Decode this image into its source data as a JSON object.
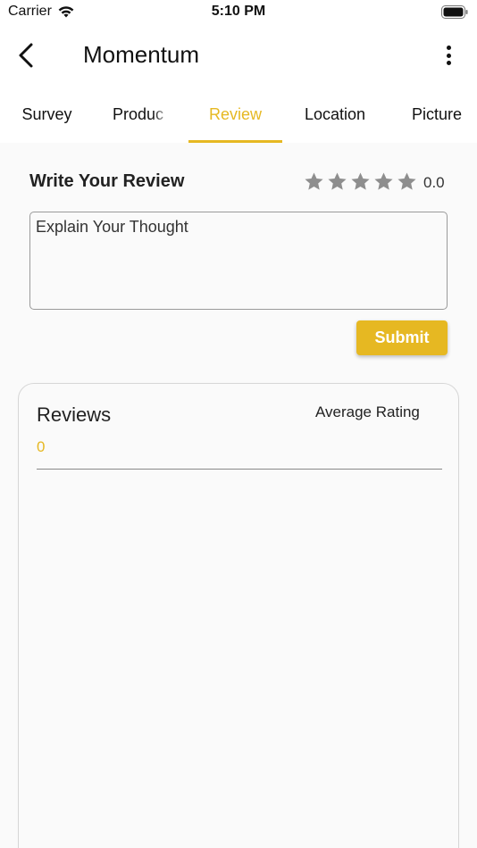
{
  "status_bar": {
    "carrier": "Carrier",
    "time": "5:10 PM"
  },
  "app_bar": {
    "title": "Momentum",
    "back_icon": "chevron-left-icon",
    "more_icon": "more-vertical-icon"
  },
  "tabs": [
    {
      "label": "Survey",
      "active": false
    },
    {
      "label": "Produc",
      "active": false
    },
    {
      "label": "Review",
      "active": true
    },
    {
      "label": "Location",
      "active": false
    },
    {
      "label": "Picture",
      "active": false
    }
  ],
  "write_review": {
    "title": "Write Your Review",
    "rating": "0.0",
    "stars_total": 5,
    "stars_filled": 0,
    "input_placeholder": "Explain Your Thought",
    "input_value": "",
    "submit_label": "Submit"
  },
  "reviews": {
    "title": "Reviews",
    "average_label": "Average Rating",
    "count": "0"
  },
  "colors": {
    "accent": "#e6b822",
    "star_empty": "#8e8e8e",
    "background": "#fafafa"
  }
}
